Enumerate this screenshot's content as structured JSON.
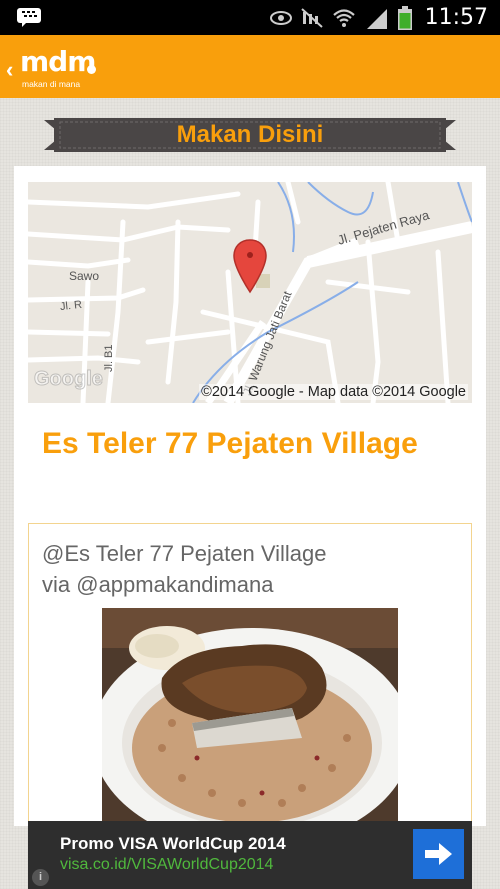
{
  "status_bar": {
    "time": "11:57",
    "icons": [
      "bbm-notification-icon",
      "eye-icon",
      "mute-icon",
      "wifi-icon",
      "signal-icon",
      "battery-icon"
    ]
  },
  "app_bar": {
    "logo_text": "mdm",
    "logo_tagline": "makan di mana",
    "back_icon": "chevron-left-icon"
  },
  "page": {
    "ribbon_title": "Makan Disini"
  },
  "map": {
    "streets": [
      "Jl. Pejaten Raya",
      "Jl. Warung Jati Barat",
      "Sawo",
      "Jl. R",
      "Jl. B1"
    ],
    "google_watermark": "Google",
    "attribution": "©2014 Google - Map data ©2014 Google",
    "marker_icon": "map-pin-icon"
  },
  "place": {
    "title": "Es Teler 77 Pejaten Village"
  },
  "post": {
    "line1": "@Es Teler 77 Pejaten Village",
    "line2": "via @appmakandimana",
    "photo_icon": "food-photo"
  },
  "ad": {
    "title": "Promo VISA WorldCup 2014",
    "url": "visa.co.id/VISAWorldCup2014",
    "button_icon": "arrow-right-icon",
    "info_icon": "info-icon"
  },
  "colors": {
    "accent": "#f99f0c",
    "ribbon": "#4a4646",
    "ad_background": "#2e2e2e",
    "ad_url": "#50b83d",
    "ad_button": "#1e6fd8"
  }
}
